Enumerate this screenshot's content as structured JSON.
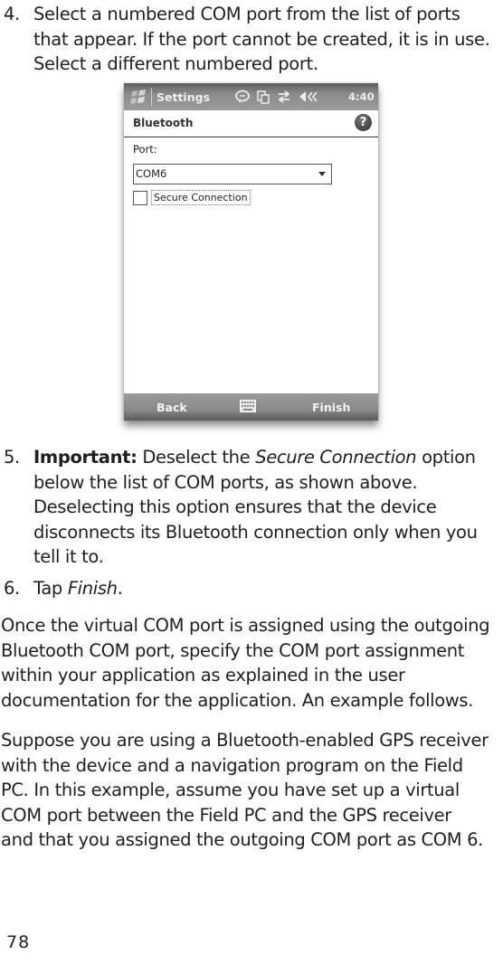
{
  "step4": {
    "number": "4.",
    "lines": [
      "Select a numbered COM port from the list of ports",
      "that appear. If the port cannot be created, it is in use.",
      "Select a different numbered port."
    ]
  },
  "screenshot": {
    "titlebar": {
      "app_title": "Settings",
      "clock": "4:40",
      "icons": [
        "windows-start-icon",
        "message-bubble-icon",
        "copy-icon",
        "connectivity-arrows-icon",
        "speaker-icon"
      ]
    },
    "header": {
      "title": "Bluetooth",
      "help_glyph": "?"
    },
    "port_label": "Port:",
    "port_select": {
      "value": "COM6"
    },
    "secure_connection": {
      "label": "Secure Connection",
      "checked": false
    },
    "bottombar": {
      "left_softkey": "Back",
      "right_softkey": "Finish"
    }
  },
  "step5": {
    "number": "5.",
    "important_label": "Important:",
    "line1_pre": " Deselect the ",
    "line1_em": "Secure Connection",
    "line1_post": " option",
    "lines": [
      "below the list of COM ports, as shown above.",
      "Deselecting this option ensures that the device",
      "disconnects its Bluetooth connection only when you",
      "tell it to."
    ]
  },
  "step6": {
    "number": "6.",
    "pre": "Tap ",
    "em": "Finish",
    "post": "."
  },
  "paragraph1": {
    "lines": [
      "Once the virtual COM port is assigned using the outgoing",
      "Bluetooth COM port, specify the COM port assignment",
      "within your application as explained in the user",
      "documentation for the application. An example follows."
    ]
  },
  "paragraph2": {
    "lines": [
      "Suppose you are using a Bluetooth-enabled GPS receiver",
      "with the device and a navigation program on the Field",
      "PC. In this example, assume you have set up a virtual",
      "COM port between the Field PC and the GPS receiver",
      "and that you assigned the outgoing COM port as COM 6."
    ]
  },
  "page_number": "78"
}
